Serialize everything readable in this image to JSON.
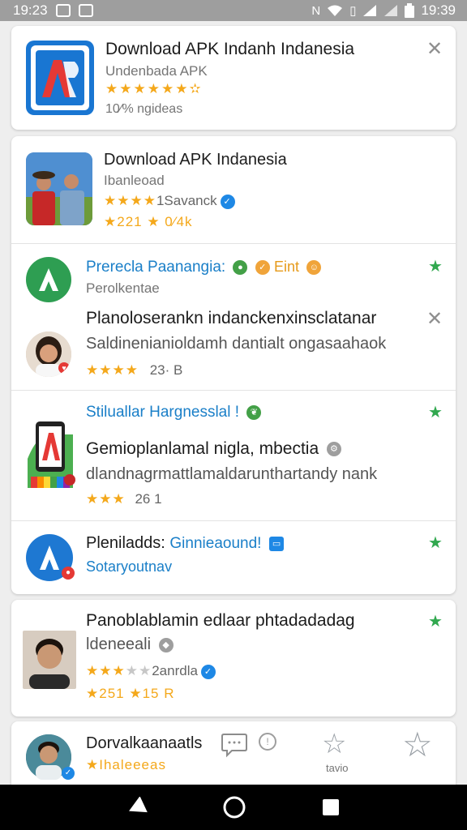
{
  "status": {
    "time_left": "19:23",
    "time_right": "19:39"
  },
  "card1": {
    "title": "Download APK Indanh Indanesia",
    "subtitle": "Undenbada APK",
    "stars": "★★★★★★",
    "half": "✫",
    "downloads": "10⁄% ngideas"
  },
  "card2": {
    "item1": {
      "title": "Download APK Indanesia",
      "subtitle": "Ibanleoad",
      "stars": "★★★★",
      "rating_text": "1Savanck",
      "meta": "★221 ★ 0⁄4k"
    },
    "item2": {
      "title": "Prerecla Paanangia:",
      "emoji": "Eint",
      "subtitle": "Perolkentae"
    },
    "item3": {
      "title": "Planoloserankn indanckenxinsclatanar",
      "desc": "Saldinenianioldamh dantialt ongasaahaok",
      "stars": "★★★★",
      "meta": "23· B"
    },
    "item4": {
      "title": "Stiluallar Hargnesslal !",
      "text": "Gemioplanlamal nigla, mbectia",
      "desc": "dlandnagrmattlamaldarunthartandy nank",
      "stars": "★★★",
      "meta": "26 1"
    },
    "item5": {
      "title": "Pleniladds:",
      "tag": "Ginnieaound!",
      "subtitle": "Sotaryoutnav"
    }
  },
  "card3": {
    "title": "Panoblablamin edlaar phtadadadag",
    "subtitle": "ldeneeali",
    "stars": "★★★",
    "stars_grey": "★★",
    "rating_text": "2anrdla",
    "meta": "★251 ★15 R"
  },
  "card4": {
    "title": "Dorvalkaanaatls",
    "subtitle": "★Ihaleeeas",
    "btn_label": "tavio"
  },
  "colors": {
    "accent_blue": "#1a7fc8",
    "star": "#f4a81b",
    "green": "#31a84f"
  },
  "icons": [
    "wifi-icon",
    "signal-icon",
    "battery-icon",
    "close-icon",
    "verified-icon",
    "back-icon",
    "home-icon",
    "recents-icon"
  ]
}
